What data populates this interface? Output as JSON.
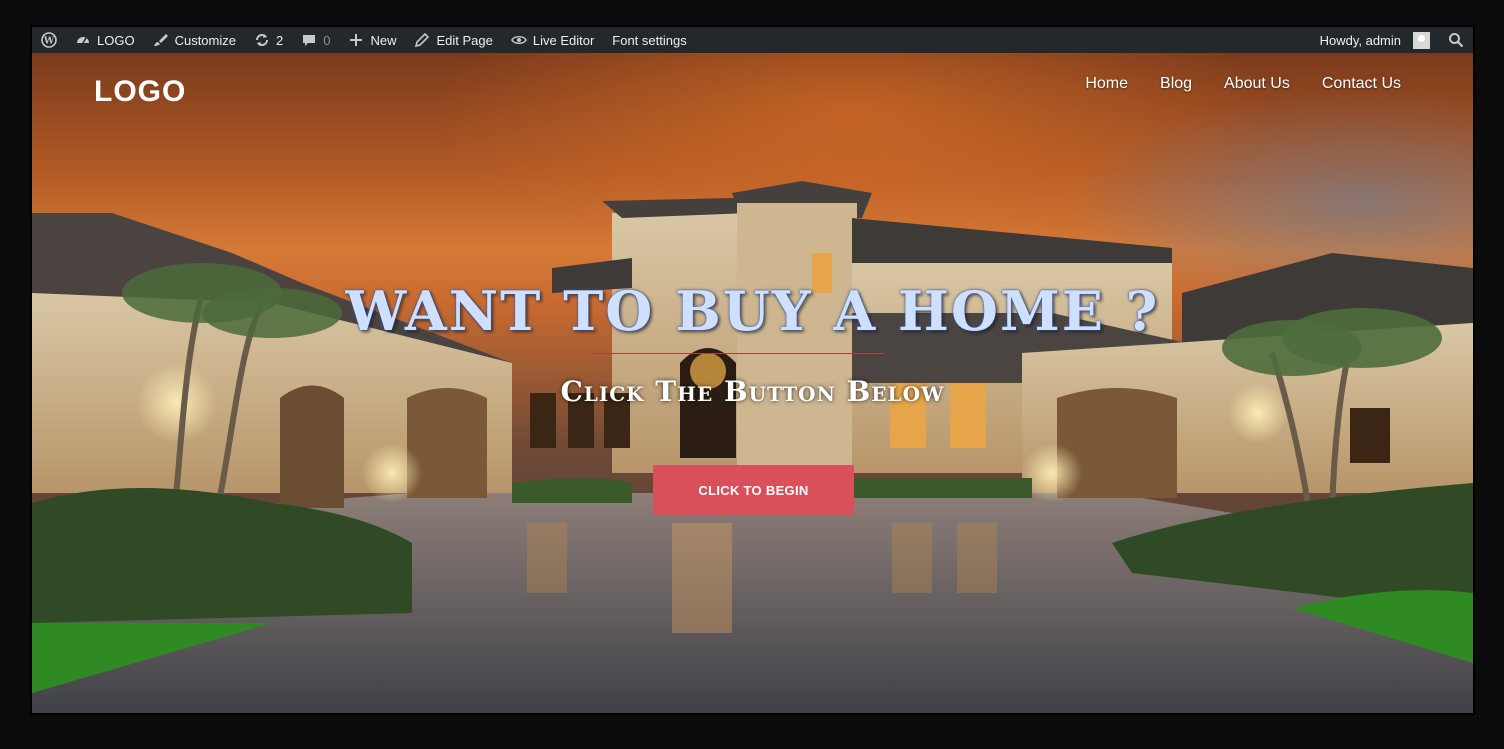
{
  "admin_bar": {
    "site_name": "LOGO",
    "customize": "Customize",
    "updates_count": "2",
    "comments_count": "0",
    "new": "New",
    "edit_page": "Edit Page",
    "live_editor": "Live Editor",
    "font_settings": "Font settings",
    "howdy": "Howdy, admin",
    "icons": [
      "wordpress-icon",
      "dashboard-icon",
      "brush-icon",
      "updates-icon",
      "comment-icon",
      "plus-icon",
      "pencil-icon",
      "eye-icon",
      "search-icon"
    ],
    "background_color": "#23282d"
  },
  "header": {
    "logo": "LOGO",
    "nav": [
      "Home",
      "Blog",
      "About Us",
      "Contact Us"
    ]
  },
  "hero": {
    "headline": "Want to Buy a Home ?",
    "subheadline": "Click The Button Below",
    "cta_label": "CLICK TO BEGIN",
    "cta_color": "#d9505b",
    "headline_color": "#cfe0ff"
  }
}
